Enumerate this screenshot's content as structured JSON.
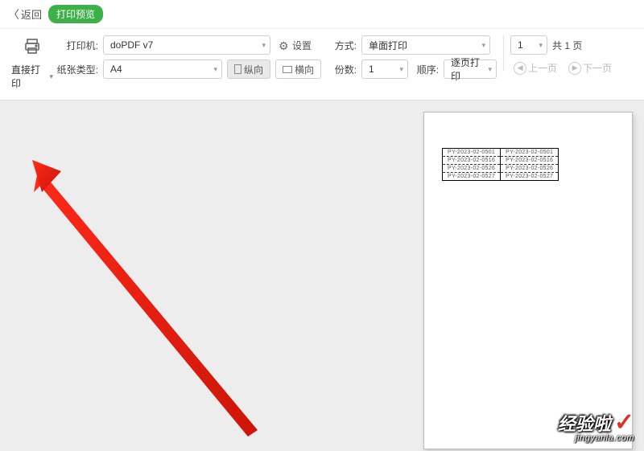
{
  "header": {
    "back_label": "返回",
    "title_badge": "打印预览"
  },
  "toolbar": {
    "print_label": "直接打印",
    "printer_label": "打印机:",
    "printer_value": "doPDF v7",
    "settings_label": "设置",
    "paper_label": "纸张类型:",
    "paper_value": "A4",
    "orient_portrait": "纵向",
    "orient_landscape": "横向",
    "side_label": "方式:",
    "side_value": "单面打印",
    "copies_label": "份数:",
    "copies_value": "1",
    "order_label": "顺序:",
    "order_value": "逐页打印",
    "page_value": "1",
    "page_total": "共 1 页",
    "prev_label": "上一页",
    "next_label": "下一页"
  },
  "preview_table": {
    "rows": [
      [
        "PY-2023-02-0501",
        "PY-2023-02-0501"
      ],
      [
        "PY-2023-02-0516",
        "PY-2023-02-0516"
      ],
      [
        "PY-2023-02-0526",
        "PY-2023-02-0526"
      ],
      [
        "PY-2023-02-0527",
        "PY-2023-02-0527"
      ]
    ]
  },
  "watermark": {
    "title": "经验啦",
    "subtitle": "jingyanla.com"
  }
}
